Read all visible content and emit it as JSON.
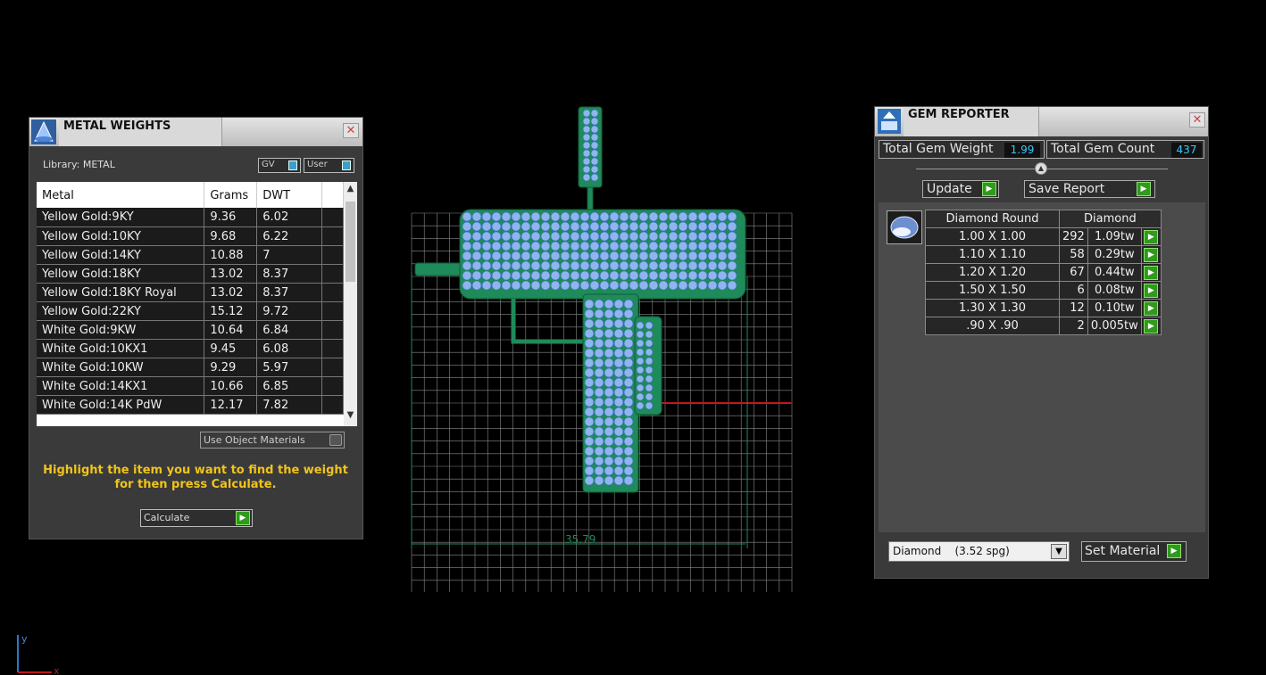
{
  "metal_weights": {
    "title": "METAL WEIGHTS",
    "close_glyph": "✕",
    "library_label": "Library: METAL",
    "toggle_gv": "GV",
    "toggle_user": "User",
    "columns": [
      "Metal",
      "Grams",
      "DWT"
    ],
    "rows": [
      [
        "Yellow Gold:9KY",
        "9.36",
        "6.02"
      ],
      [
        "Yellow Gold:10KY",
        "9.68",
        "6.22"
      ],
      [
        "Yellow Gold:14KY",
        "10.88",
        "7"
      ],
      [
        "Yellow Gold:18KY",
        "13.02",
        "8.37"
      ],
      [
        "Yellow Gold:18KY Royal",
        "13.02",
        "8.37"
      ],
      [
        "Yellow Gold:22KY",
        "15.12",
        "9.72"
      ],
      [
        "White Gold:9KW",
        "10.64",
        "6.84"
      ],
      [
        "White Gold:10KX1",
        "9.45",
        "6.08"
      ],
      [
        "White Gold:10KW",
        "9.29",
        "5.97"
      ],
      [
        "White Gold:14KX1",
        "10.66",
        "6.85"
      ],
      [
        "White Gold:14K PdW",
        "12.17",
        "7.82"
      ]
    ],
    "use_object_materials": "Use Object Materials",
    "hint": "Highlight the item you want to find the weight for then press Calculate.",
    "calculate_label": "Calculate",
    "play_glyph": "▶"
  },
  "viewport": {
    "dimension_label": "35.79",
    "axis_y": "y",
    "axis_x": "x",
    "colors": {
      "model": "#1f8a5a",
      "gems": "#8fb4ee",
      "grid": "#8a8a8a",
      "red_axis": "#c01818"
    }
  },
  "gem_reporter": {
    "title": "GEM REPORTER",
    "close_glyph": "✕",
    "total_weight_label": "Total Gem Weight",
    "total_weight_value": "1.99",
    "total_count_label": "Total Gem Count",
    "total_count_value": "437",
    "update_label": "Update",
    "save_report_label": "Save Report",
    "play_glyph": "▶",
    "gem_columns": [
      "Diamond Round",
      "Diamond"
    ],
    "gem_rows": [
      [
        "1.00 X 1.00",
        "292",
        "1.09tw"
      ],
      [
        "1.10 X 1.10",
        "58",
        "0.29tw"
      ],
      [
        "1.20 X 1.20",
        "67",
        "0.44tw"
      ],
      [
        "1.50 X 1.50",
        "6",
        "0.08tw"
      ],
      [
        "1.30 X 1.30",
        "12",
        "0.10tw"
      ],
      [
        ".90 X .90",
        "2",
        "0.005tw"
      ]
    ],
    "material_value": "Diamond    (3.52 spg)",
    "dropdown_glyph": "▼",
    "set_material_label": "Set Material"
  }
}
